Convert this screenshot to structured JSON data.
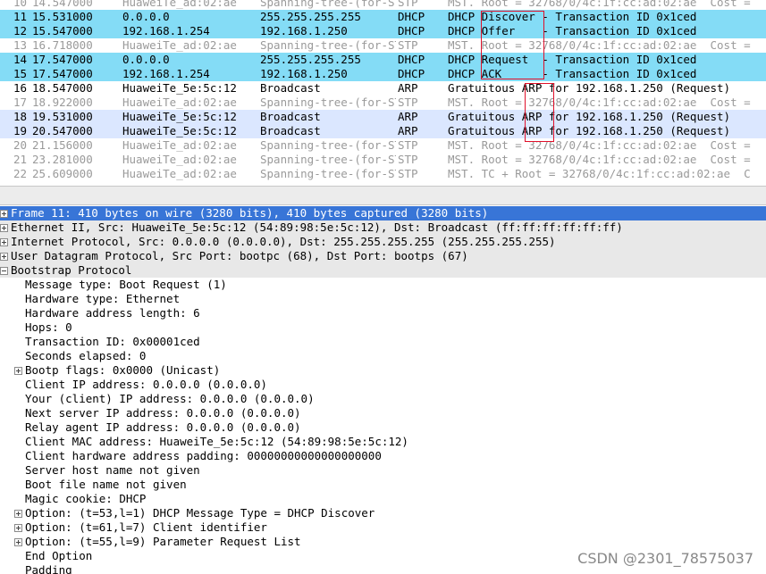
{
  "packets": [
    {
      "no": "10",
      "time": "14.547000",
      "src": "HuaweiTe_ad:02:ae",
      "dst": "Spanning-tree-(for-STP",
      "proto": "STP",
      "info": "MST. Root = 32768/0/4c:1f:cc:ad:02:ae  Cost =",
      "style": "dim"
    },
    {
      "no": "11",
      "time": "15.531000",
      "src": "0.0.0.0",
      "dst": "255.255.255.255",
      "proto": "DHCP",
      "info": "DHCP Discover - Transaction ID 0x1ced",
      "style": "dhcp"
    },
    {
      "no": "12",
      "time": "15.547000",
      "src": "192.168.1.254",
      "dst": "192.168.1.250",
      "proto": "DHCP",
      "info": "DHCP Offer    - Transaction ID 0x1ced",
      "style": "dhcp"
    },
    {
      "no": "13",
      "time": "16.718000",
      "src": "HuaweiTe_ad:02:ae",
      "dst": "Spanning-tree-(for-STP",
      "proto": "STP",
      "info": "MST. Root = 32768/0/4c:1f:cc:ad:02:ae  Cost =",
      "style": "dim"
    },
    {
      "no": "14",
      "time": "17.547000",
      "src": "0.0.0.0",
      "dst": "255.255.255.255",
      "proto": "DHCP",
      "info": "DHCP Request  - Transaction ID 0x1ced",
      "style": "dhcp"
    },
    {
      "no": "15",
      "time": "17.547000",
      "src": "192.168.1.254",
      "dst": "192.168.1.250",
      "proto": "DHCP",
      "info": "DHCP ACK      - Transaction ID 0x1ced",
      "style": "dhcp"
    },
    {
      "no": "16",
      "time": "18.547000",
      "src": "HuaweiTe_5e:5c:12",
      "dst": "Broadcast",
      "proto": "ARP",
      "info": "Gratuitous ARP for 192.168.1.250 (Request)",
      "style": "arp alt"
    },
    {
      "no": "17",
      "time": "18.922000",
      "src": "HuaweiTe_ad:02:ae",
      "dst": "Spanning-tree-(for-STP",
      "proto": "STP",
      "info": "MST. Root = 32768/0/4c:1f:cc:ad:02:ae  Cost =",
      "style": "dim"
    },
    {
      "no": "18",
      "time": "19.531000",
      "src": "HuaweiTe_5e:5c:12",
      "dst": "Broadcast",
      "proto": "ARP",
      "info": "Gratuitous ARP for 192.168.1.250 (Request)",
      "style": "arp"
    },
    {
      "no": "19",
      "time": "20.547000",
      "src": "HuaweiTe_5e:5c:12",
      "dst": "Broadcast",
      "proto": "ARP",
      "info": "Gratuitous ARP for 192.168.1.250 (Request)",
      "style": "arp"
    },
    {
      "no": "20",
      "time": "21.156000",
      "src": "HuaweiTe_ad:02:ae",
      "dst": "Spanning-tree-(for-STP",
      "proto": "STP",
      "info": "MST. Root = 32768/0/4c:1f:cc:ad:02:ae  Cost =",
      "style": "dim"
    },
    {
      "no": "21",
      "time": "23.281000",
      "src": "HuaweiTe_ad:02:ae",
      "dst": "Spanning-tree-(for-STP",
      "proto": "STP",
      "info": "MST. Root = 32768/0/4c:1f:cc:ad:02:ae  Cost =",
      "style": "dim"
    },
    {
      "no": "22",
      "time": "25.609000",
      "src": "HuaweiTe_ad:02:ae",
      "dst": "Spanning-tree-(for-STP",
      "proto": "STP",
      "info": "MST. TC + Root = 32768/0/4c:1f:cc:ad:02:ae  C",
      "style": "dim"
    }
  ],
  "details": [
    {
      "text": "Frame 11: 410 bytes on wire (3280 bits), 410 bytes captured (3280 bits)",
      "level": 0,
      "expander": "plus",
      "style": "selected"
    },
    {
      "text": "Ethernet II, Src: HuaweiTe_5e:5c:12 (54:89:98:5e:5c:12), Dst: Broadcast (ff:ff:ff:ff:ff:ff)",
      "level": 0,
      "expander": "plus",
      "style": "header"
    },
    {
      "text": "Internet Protocol, Src: 0.0.0.0 (0.0.0.0), Dst: 255.255.255.255 (255.255.255.255)",
      "level": 0,
      "expander": "plus",
      "style": "header"
    },
    {
      "text": "User Datagram Protocol, Src Port: bootpc (68), Dst Port: bootps (67)",
      "level": 0,
      "expander": "plus",
      "style": "header"
    },
    {
      "text": "Bootstrap Protocol",
      "level": 0,
      "expander": "minus",
      "style": "header"
    },
    {
      "text": "Message type: Boot Request (1)",
      "level": 1,
      "expander": "",
      "style": ""
    },
    {
      "text": "Hardware type: Ethernet",
      "level": 1,
      "expander": "",
      "style": ""
    },
    {
      "text": "Hardware address length: 6",
      "level": 1,
      "expander": "",
      "style": ""
    },
    {
      "text": "Hops: 0",
      "level": 1,
      "expander": "",
      "style": ""
    },
    {
      "text": "Transaction ID: 0x00001ced",
      "level": 1,
      "expander": "",
      "style": ""
    },
    {
      "text": "Seconds elapsed: 0",
      "level": 1,
      "expander": "",
      "style": ""
    },
    {
      "text": "Bootp flags: 0x0000 (Unicast)",
      "level": 1,
      "expander": "plus",
      "style": ""
    },
    {
      "text": "Client IP address: 0.0.0.0 (0.0.0.0)",
      "level": 1,
      "expander": "",
      "style": ""
    },
    {
      "text": "Your (client) IP address: 0.0.0.0 (0.0.0.0)",
      "level": 1,
      "expander": "",
      "style": ""
    },
    {
      "text": "Next server IP address: 0.0.0.0 (0.0.0.0)",
      "level": 1,
      "expander": "",
      "style": ""
    },
    {
      "text": "Relay agent IP address: 0.0.0.0 (0.0.0.0)",
      "level": 1,
      "expander": "",
      "style": ""
    },
    {
      "text": "Client MAC address: HuaweiTe_5e:5c:12 (54:89:98:5e:5c:12)",
      "level": 1,
      "expander": "",
      "style": ""
    },
    {
      "text": "Client hardware address padding: 00000000000000000000",
      "level": 1,
      "expander": "",
      "style": ""
    },
    {
      "text": "Server host name not given",
      "level": 1,
      "expander": "",
      "style": ""
    },
    {
      "text": "Boot file name not given",
      "level": 1,
      "expander": "",
      "style": ""
    },
    {
      "text": "Magic cookie: DHCP",
      "level": 1,
      "expander": "",
      "style": ""
    },
    {
      "text": "Option: (t=53,l=1) DHCP Message Type = DHCP Discover",
      "level": 1,
      "expander": "plus",
      "style": ""
    },
    {
      "text": "Option: (t=61,l=7) Client identifier",
      "level": 1,
      "expander": "plus",
      "style": ""
    },
    {
      "text": "Option: (t=55,l=9) Parameter Request List",
      "level": 1,
      "expander": "plus",
      "style": ""
    },
    {
      "text": "End Option",
      "level": 1,
      "expander": "",
      "style": ""
    },
    {
      "text": "Padding",
      "level": 1,
      "expander": "",
      "style": ""
    }
  ],
  "watermark": "CSDN @2301_78575037",
  "colors": {
    "dhcp_row": "#84dcf6",
    "arp_row": "#dbe7ff",
    "selected": "#3875d7",
    "annotation": "#e0102a"
  }
}
